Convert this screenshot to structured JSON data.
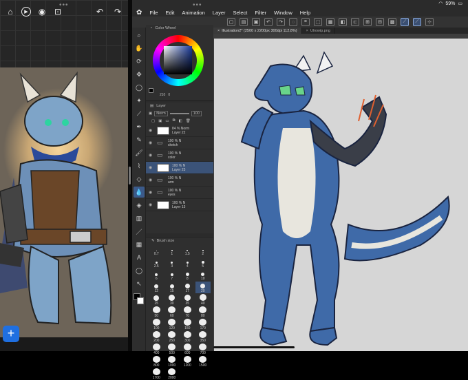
{
  "left_pane": {
    "toolbar_icons": [
      "house-icon",
      "play-icon",
      "eye-icon",
      "lock-icon",
      "undo-icon",
      "redo-icon"
    ],
    "add_label": "+"
  },
  "status": {
    "battery": "59%"
  },
  "menu": {
    "items": [
      "File",
      "Edit",
      "Animation",
      "Layer",
      "Select",
      "Filter",
      "Window",
      "Help"
    ]
  },
  "color_panel": {
    "title": "Color Wheel",
    "value_a": "210",
    "value_b": "0"
  },
  "layer_panel": {
    "title": "Layer",
    "blend_mode": "Norm",
    "opacity": "100",
    "layers": [
      {
        "pct": "84 %",
        "mode": "Norm",
        "name": "Layer 22",
        "folder": false,
        "selected": false
      },
      {
        "pct": "100 %",
        "mode": "N",
        "name": "sketch",
        "folder": true,
        "selected": false
      },
      {
        "pct": "100 %",
        "mode": "N",
        "name": "color",
        "folder": true,
        "selected": false
      },
      {
        "pct": "100 %",
        "mode": "N",
        "name": "Layer 23",
        "folder": false,
        "selected": true
      },
      {
        "pct": "100 %",
        "mode": "N",
        "name": "arm",
        "folder": true,
        "selected": false
      },
      {
        "pct": "100 %",
        "mode": "N",
        "name": "eyes",
        "folder": true,
        "selected": false
      },
      {
        "pct": "100 %",
        "mode": "N",
        "name": "Layer 13",
        "folder": false,
        "selected": false
      }
    ]
  },
  "brush_panel": {
    "title": "Brush size",
    "sizes": [
      "0.7",
      "1",
      "1.5",
      "2",
      "2.5",
      "3",
      "4",
      "5",
      "6",
      "7",
      "8",
      "10",
      "12",
      "15",
      "17",
      "20",
      "25",
      "30",
      "35",
      "40",
      "50",
      "60",
      "70",
      "80",
      "100",
      "120",
      "150",
      "170",
      "200",
      "250",
      "300",
      "350",
      "400",
      "500",
      "600",
      "700",
      "800",
      "1000",
      "1200",
      "1500",
      "1700",
      "2000"
    ]
  },
  "tabs": [
    {
      "label": "Illustration2* (2500 x 2200px 300dpi 112.8%)",
      "active": true
    },
    {
      "label": "Ulrowip.png",
      "active": false
    }
  ]
}
